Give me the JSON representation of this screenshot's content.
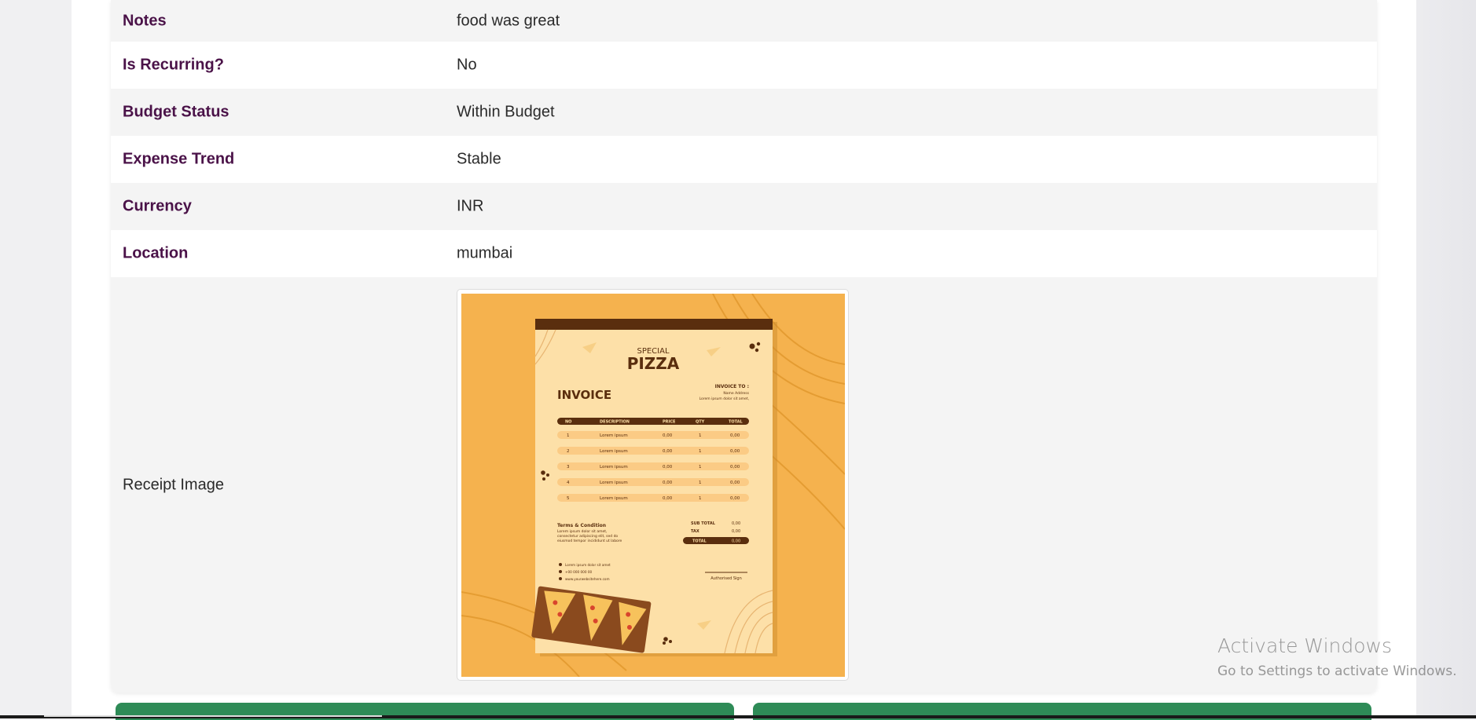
{
  "details": {
    "rows": [
      {
        "label": "Notes",
        "value": "food was great"
      },
      {
        "label": "Is Recurring?",
        "value": "No"
      },
      {
        "label": "Budget Status",
        "value": "Within Budget"
      },
      {
        "label": "Expense Trend",
        "value": "Stable"
      },
      {
        "label": "Currency",
        "value": "INR"
      },
      {
        "label": "Location",
        "value": "mumbai"
      }
    ],
    "receipt_label": "Receipt Image"
  },
  "receipt": {
    "special": "SPECIAL",
    "pizza": "PIZZA",
    "invoice": "INVOICE",
    "invoice_to": "INVOICE TO :",
    "name_address": "Name Address",
    "lorem_addr": "Lorem ipsum dolor sit amet,",
    "headers": [
      "NO",
      "DESCRIPTION",
      "PRICE",
      "QTY",
      "TOTAL"
    ],
    "items": [
      [
        "1",
        "Lorem ipsum",
        "0,00",
        "1",
        "0,00"
      ],
      [
        "2",
        "Lorem ipsum",
        "0,00",
        "1",
        "0,00"
      ],
      [
        "3",
        "Lorem ipsum",
        "0,00",
        "1",
        "0,00"
      ],
      [
        "4",
        "Lorem ipsum",
        "0,00",
        "1",
        "0,00"
      ],
      [
        "5",
        "Lorem ipsum",
        "0,00",
        "1",
        "0,00"
      ]
    ],
    "terms_title": "Terms & Condition",
    "terms_l1": "Lorem ipsum dolor sit amet,",
    "terms_l2": "consectetur adipiscing elit, sed do",
    "terms_l3": "eiusmod tempor incididunt ut labore",
    "subtotal_label": "SUB TOTAL",
    "subtotal_value": "0,00",
    "tax_label": "TAX",
    "tax_value": "0,00",
    "total_label": "TOTAL",
    "total_value": "0,00",
    "contact_address": "Lorem ipsum dolor sit amet",
    "contact_phone": "+00 000 000 00",
    "contact_web": "www.yourwebsitehere.com",
    "sign": "Authorised Sign"
  },
  "watermark": {
    "title": "Activate Windows",
    "subtitle": "Go to Settings to activate Windows."
  },
  "colors": {
    "label": "#4a1248",
    "accent_green": "#2e8b57",
    "receipt_bg": "#f5b24e",
    "receipt_paper": "#fde0a8",
    "receipt_dark": "#5a2e0e"
  }
}
